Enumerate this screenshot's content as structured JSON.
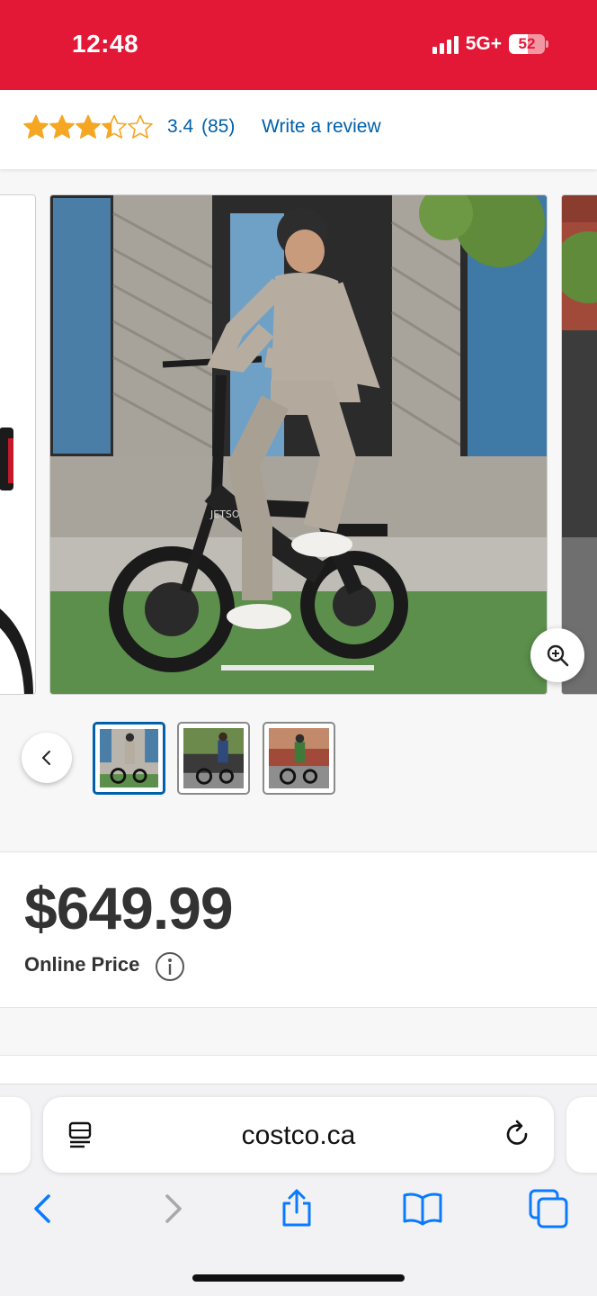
{
  "status_bar": {
    "time": "12:48",
    "network": "5G+",
    "battery_percent": "52",
    "battery_level": 0.52,
    "bg_color": "#e31837"
  },
  "rating": {
    "stars_value": 3.4,
    "stars_max": 5,
    "value_text": "3.4",
    "count_text": "(85)",
    "write_review_label": "Write a review",
    "link_color": "#0060a9",
    "star_color": "#f5a623"
  },
  "gallery": {
    "main_image_icon": "product-photo-man-riding-black-folding-ebike",
    "brand_on_bike": "JETSON",
    "zoom_icon": "zoom-in-icon",
    "prev_icon": "chevron-left-icon",
    "thumbnails": [
      {
        "icon": "thumb-man-on-ebike",
        "selected": true
      },
      {
        "icon": "thumb-woman-on-ebike",
        "selected": false
      },
      {
        "icon": "thumb-rider-street-ebike",
        "selected": false
      }
    ]
  },
  "price": {
    "amount": "$649.99",
    "label": "Online Price",
    "info_icon": "info-icon"
  },
  "browser": {
    "url": "costco.ca",
    "reader_icon": "reader-mode-icon",
    "reload_icon": "reload-icon",
    "toolbar": [
      "back-icon",
      "forward-icon",
      "share-icon",
      "bookmarks-icon",
      "tabs-icon"
    ]
  }
}
